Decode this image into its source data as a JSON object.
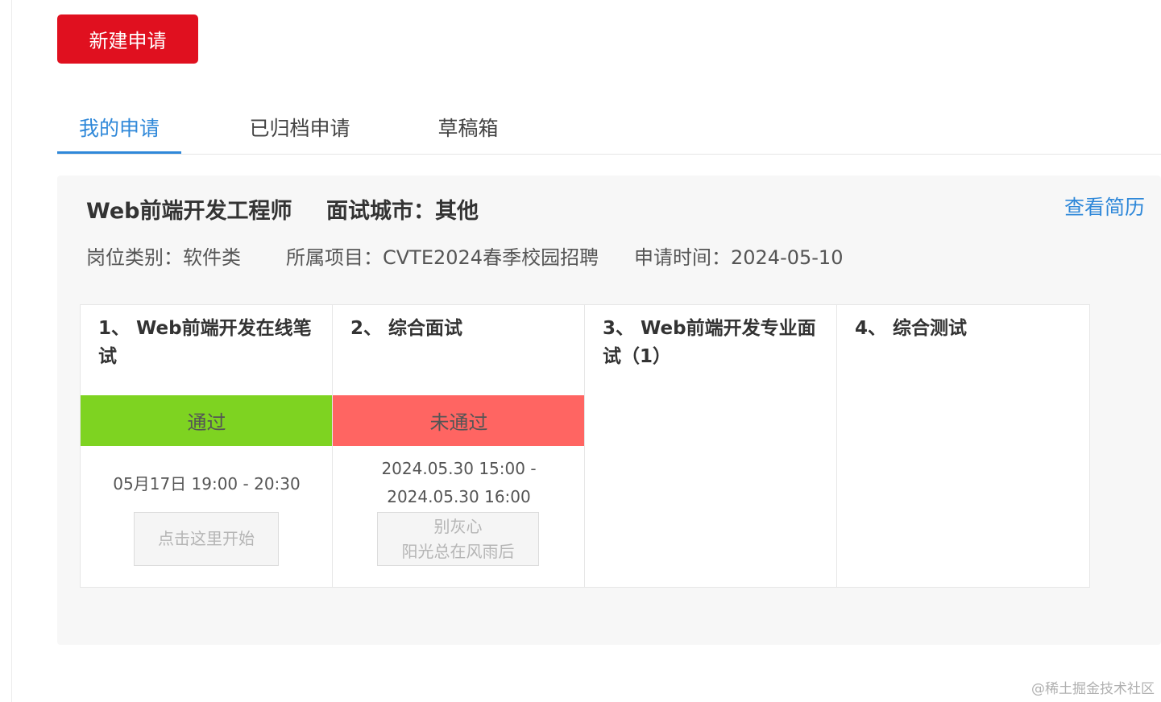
{
  "new_application_button": "新建申请",
  "tabs": [
    {
      "label": "我的申请",
      "active": true
    },
    {
      "label": "已归档申请",
      "active": false
    },
    {
      "label": "草稿箱",
      "active": false
    }
  ],
  "application": {
    "job_title": "Web前端开发工程师",
    "city": "面试城市：其他",
    "view_resume": "查看简历",
    "category": "岗位类别：软件类",
    "project": "所属项目：CVTE2024春季校园招聘",
    "apply_time": "申请时间：2024-05-10",
    "stages": [
      {
        "title": "1、 Web前端开发在线笔试",
        "status": "通过",
        "time": "05月17日 19:00 - 20:30",
        "button": "点击这里开始"
      },
      {
        "title": "2、 综合面试",
        "status": "未通过",
        "time": "2024.05.30 15:00 - 2024.05.30 16:00",
        "button_line1": "别灰心",
        "button_line2": "阳光总在风雨后"
      },
      {
        "title": "3、 Web前端开发专业面试（1）"
      },
      {
        "title": "4、 综合测试"
      }
    ]
  },
  "colors": {
    "brand_red": "#e0101f",
    "link_blue": "#2f88d9",
    "pass_green": "#7ed321",
    "fail_red": "#ff6562"
  },
  "watermark": "@稀土掘金技术社区"
}
